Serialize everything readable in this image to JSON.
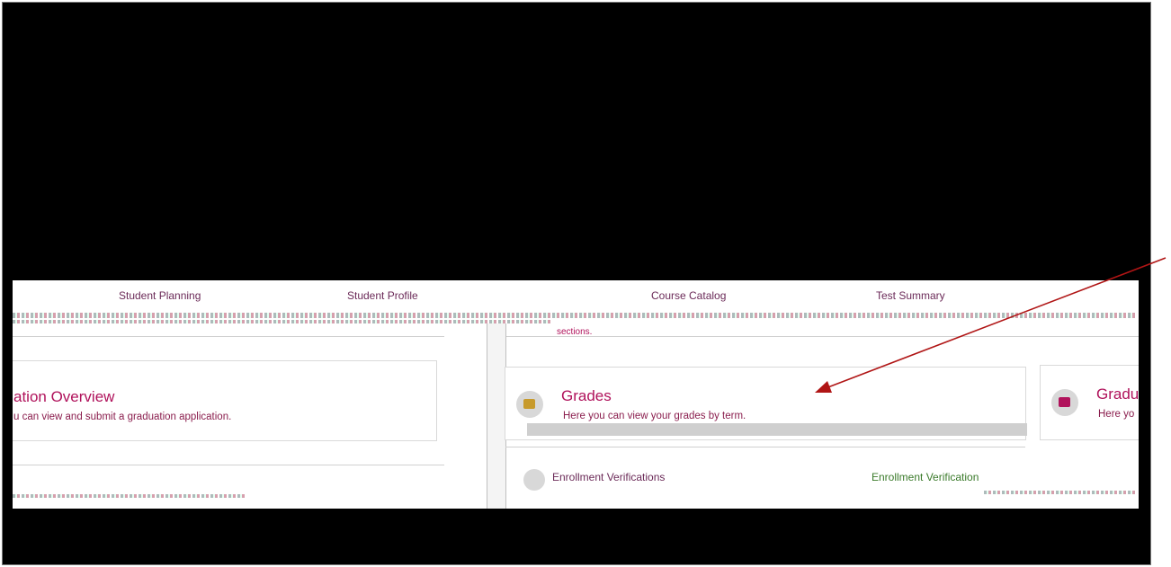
{
  "top_row": {
    "labels": [
      "Student Planning",
      "Student Profile",
      "Course Catalog",
      "Test Summary"
    ],
    "note": "sections."
  },
  "cards": [
    {
      "title": "ation Overview",
      "desc": "u can view and submit a graduation application."
    },
    {
      "title": "Grades",
      "desc": "Here you can view your grades by term."
    },
    {
      "title": "Gradu",
      "desc": "Here yo"
    }
  ],
  "bottom_row": {
    "labels": [
      "Enrollment Verifications",
      "Enrollment Verification"
    ]
  },
  "colors": {
    "accent": "#b0125b",
    "arrow": "#b01515",
    "frame": "#000000"
  }
}
